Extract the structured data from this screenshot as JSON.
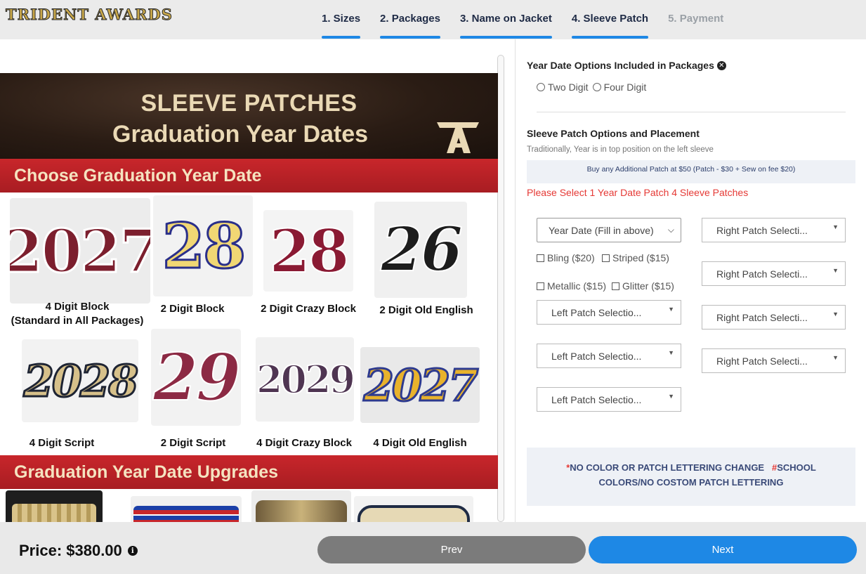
{
  "header": {
    "logo": "TRIDENT AWARDS",
    "steps": [
      {
        "label": "1. Sizes",
        "state": "active"
      },
      {
        "label": "2. Packages",
        "state": "active"
      },
      {
        "label": "3. Name on Jacket",
        "state": "active"
      },
      {
        "label": "4. Sleeve Patch",
        "state": "active"
      },
      {
        "label": "5. Payment",
        "state": "disabled"
      }
    ]
  },
  "flyer": {
    "title_line1": "SLEEVE PATCHES",
    "title_line2": "Graduation Year Dates",
    "section1": "Choose Graduation Year Date",
    "section2": "Graduation Year Date Upgrades",
    "patches_row1": [
      {
        "number": "2027",
        "caption": "4 Digit Block",
        "caption2": "(Standard in All Packages)"
      },
      {
        "number": "28",
        "caption": "2 Digit Block"
      },
      {
        "number": "28",
        "caption": "2 Digit Crazy Block"
      },
      {
        "number": "26",
        "caption": "2 Digit Old English"
      }
    ],
    "patches_row2": [
      {
        "number": "2028",
        "caption": "4 Digit Script"
      },
      {
        "number": "29",
        "caption": "2 Digit Script"
      },
      {
        "number": "2029",
        "caption": "4 Digit Crazy Block"
      },
      {
        "number": "2027",
        "caption": "4 Digit Old English"
      }
    ]
  },
  "form": {
    "year_title": "Year Date Options Included in Packages",
    "radio_two": "Two Digit",
    "radio_four": "Four Digit",
    "sleeve_title": "Sleeve Patch Options and Placement",
    "hint": "Traditionally, Year is in top position on the left sleeve",
    "additional_note": "Buy any Additional Patch at $50 (Patch - $30 + Sew on fee $20)",
    "warning": "Please Select 1 Year Date Patch 4 Sleeve Patches",
    "year_select": "Year Date (Fill in above)",
    "checks": {
      "bling": "Bling ($20)",
      "striped": "Striped ($15)",
      "metallic": "Metallic ($15)",
      "glitter": "Glitter ($15)"
    },
    "left_select": "Left Patch Selectio...",
    "right_select": "Right Patch Selecti...",
    "policy_star": "*",
    "policy_1": "NO COLOR OR PATCH LETTERING CHANGE",
    "policy_hash": "#",
    "policy_2": "SCHOOL COLORS/NO COSTOM PATCH LETTERING"
  },
  "footer": {
    "price": "Price: $380.00",
    "prev": "Prev",
    "next": "Next"
  },
  "colors": {
    "accent": "#1e88e5",
    "warning": "#e53935",
    "banner_red": "#c8262b"
  }
}
